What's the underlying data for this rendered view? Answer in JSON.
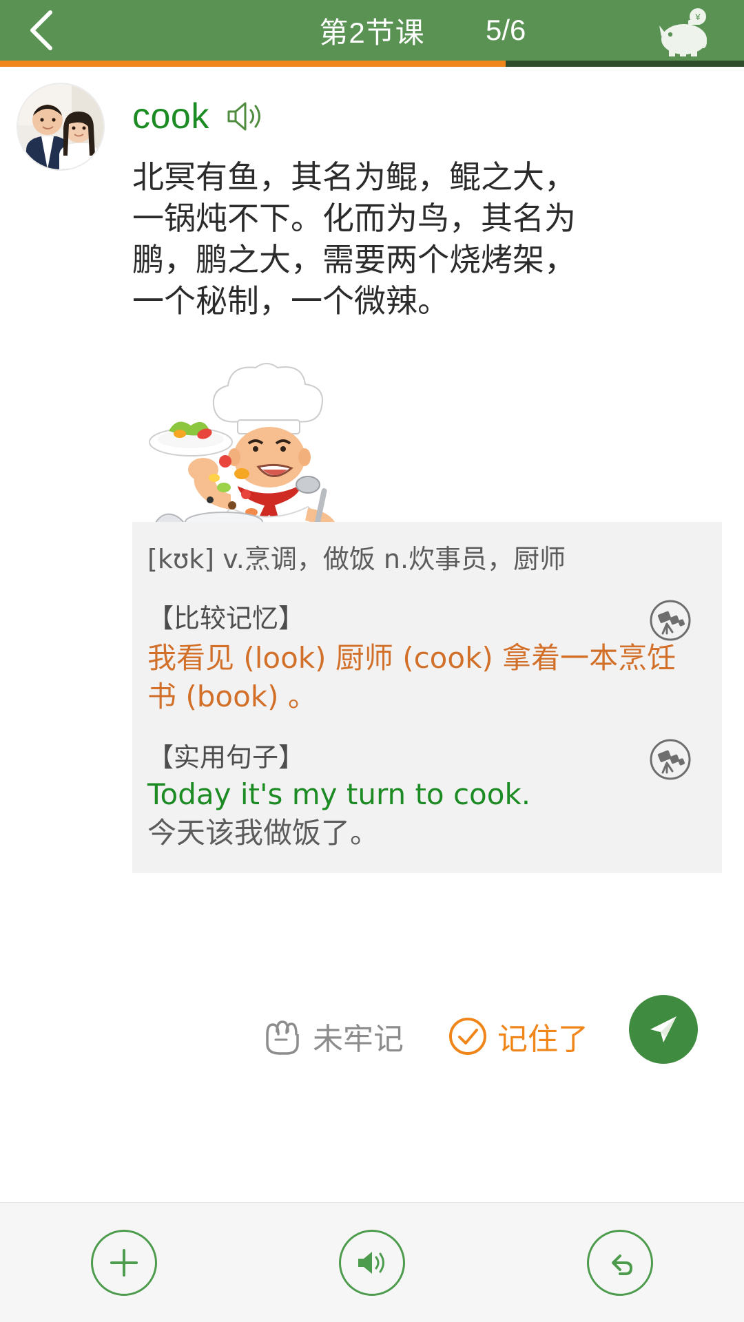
{
  "header": {
    "back_icon": "chevron-left-icon",
    "title": "第2节课",
    "counter": "5/6",
    "piggy_icon": "piggy-bank-icon",
    "bg_color": "#5a9254"
  },
  "progress": {
    "percent": 68,
    "fill_color": "#f08519",
    "track_color": "#2f4d2a"
  },
  "card": {
    "avatar_name": "user-avatar-photo",
    "word": "cook",
    "word_color": "#1d8b23",
    "speaker_icon": "speaker-icon",
    "passage": "北冥有鱼，其名为鲲，鲲之大，一锅炖不下。化而为鸟，其名为鹏，鹏之大，需要两个烧烤架，一个秘制，一个微辣。",
    "illustration_name": "chef-cooking-illustration"
  },
  "definition": {
    "phonetic_and_meaning": "[kʊk] v.烹调，做饭 n.炊事员，厨师",
    "compare": {
      "heading": "【比较记忆】",
      "text": "我看见 (look) 厨师 (cook) 拿着一本烹饪书 (book) 。",
      "color": "#d2702a",
      "icon": "telescope-icon"
    },
    "sentence": {
      "heading": "【实用句子】",
      "english": "Today it's my turn to cook.",
      "chinese": "今天该我做饭了。",
      "english_color": "#1d8b23",
      "icon": "telescope-icon"
    },
    "bg_color": "#f2f2f2"
  },
  "actions": {
    "not_memorized": {
      "label": "未牢记",
      "icon": "fist-icon",
      "color": "#8c8c8c"
    },
    "memorized": {
      "label": "记住了",
      "icon": "check-circle-icon",
      "color": "#f08519"
    },
    "send": {
      "icon": "send-paper-plane-icon",
      "color": "#3f8b3f"
    }
  },
  "bottom_bar": {
    "items": [
      {
        "name": "add-button",
        "icon": "plus-circle-icon"
      },
      {
        "name": "sound-button",
        "icon": "speaker-circle-icon"
      },
      {
        "name": "undo-button",
        "icon": "undo-arrow-circle-icon"
      }
    ],
    "accent_color": "#4d9b4d"
  }
}
